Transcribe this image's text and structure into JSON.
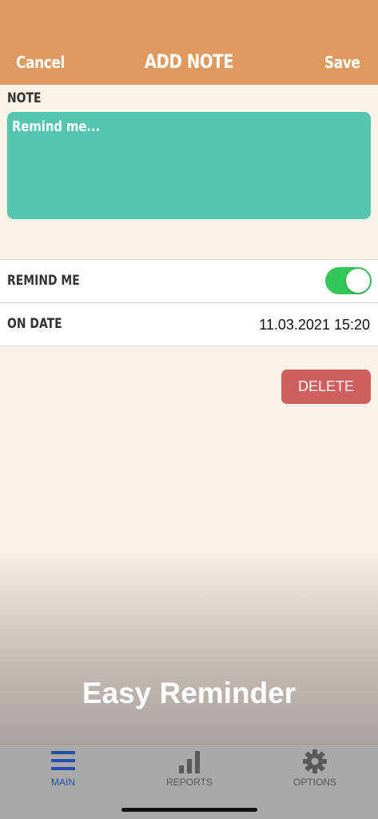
{
  "header": {
    "cancel_label": "Cancel",
    "title": "ADD NOTE",
    "save_label": "Save"
  },
  "note": {
    "label": "NOTE",
    "placeholder": "Remind me..."
  },
  "settings": {
    "remind_me_label": "REMIND ME",
    "remind_me_on": true,
    "on_date_label": "ON DATE",
    "on_date_value": "11.03.2021 15:20"
  },
  "delete_label": "DELETE",
  "app_name": "Easy Reminder",
  "tabs": [
    {
      "label": "MAIN",
      "icon": "menu-icon",
      "active": true
    },
    {
      "label": "REPORTS",
      "icon": "bar-chart-icon",
      "active": false
    },
    {
      "label": "OPTIONS",
      "icon": "gear-icon",
      "active": false
    }
  ],
  "colors": {
    "header": "#e0995f",
    "note_box": "#56c5b0",
    "toggle_on": "#34c759",
    "delete": "#cf5e5e",
    "active_tab": "#1f4fa8"
  }
}
